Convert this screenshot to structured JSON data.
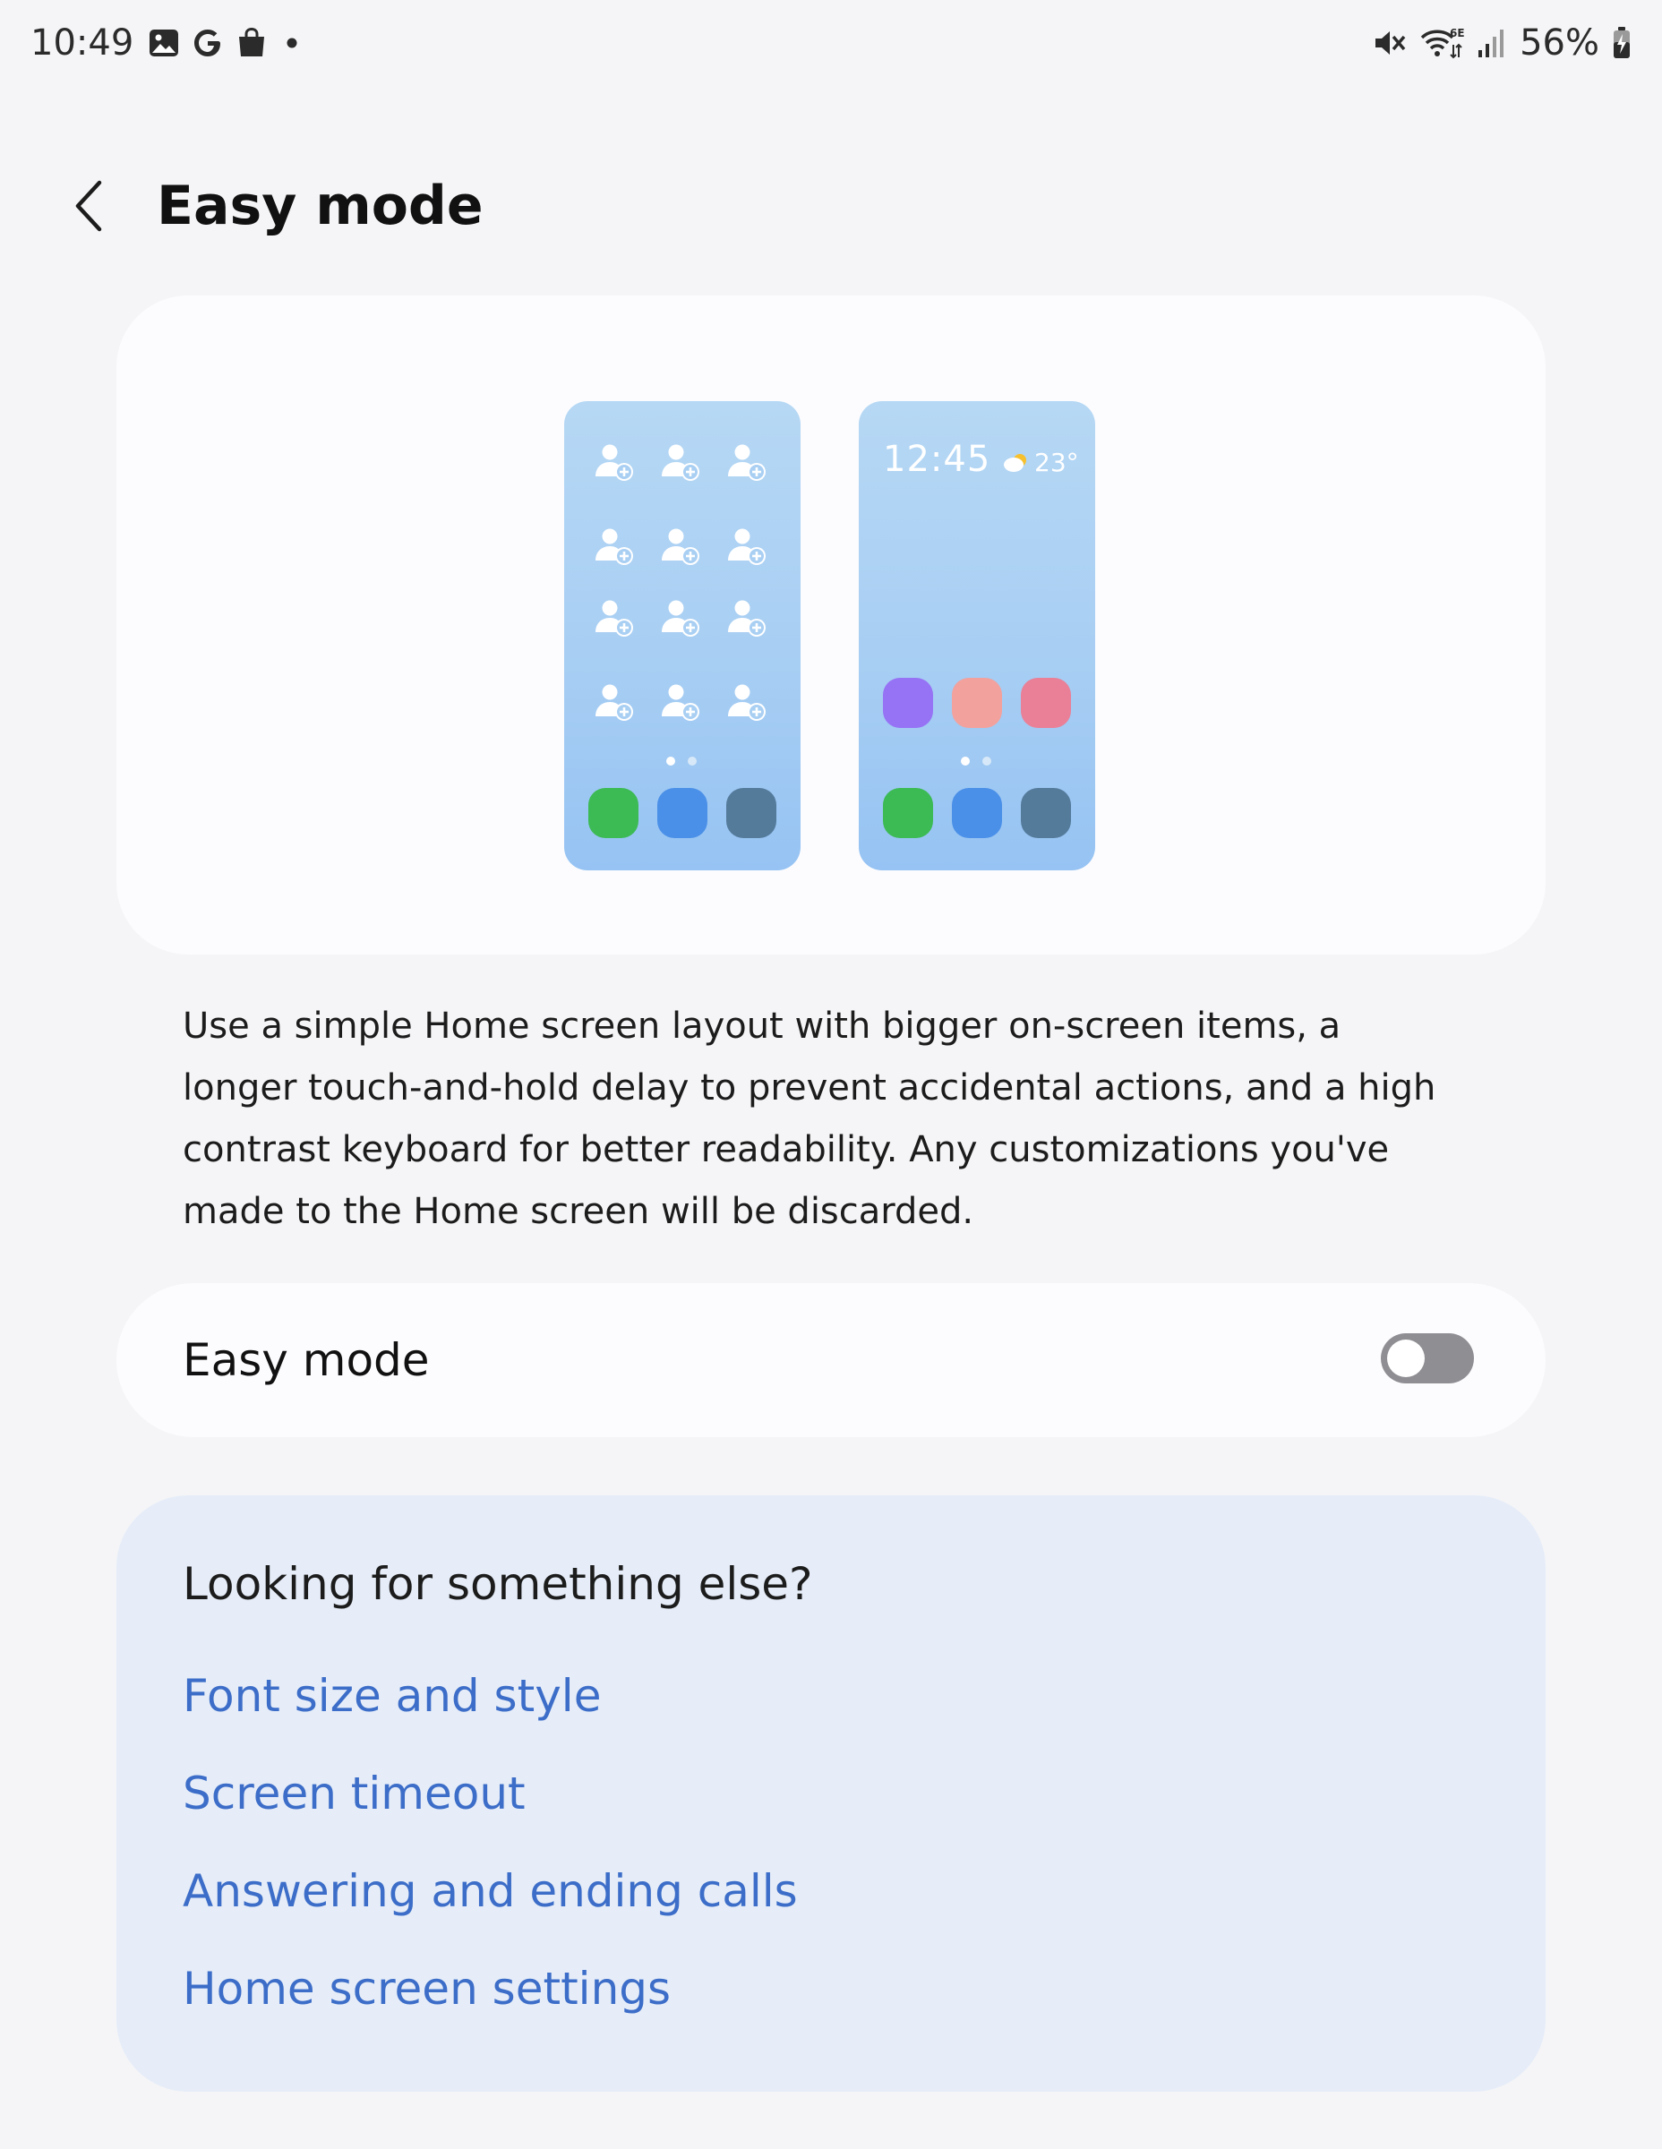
{
  "status_bar": {
    "time": "10:49",
    "left_icons": [
      "gallery-icon",
      "google-icon",
      "shopping-bag-icon",
      "notification-dot-icon"
    ],
    "right_icons": [
      "mute-icon",
      "wifi-6e-icon",
      "cellular-signal-icon",
      "battery-charging-icon"
    ],
    "battery_percent": "56%"
  },
  "header": {
    "title": "Easy mode",
    "back_icon": "chevron-left-icon"
  },
  "illustration": {
    "standard_phone": {
      "contact_icon": "add-contact-icon",
      "dock_colors": [
        "#3cba54",
        "#4a90e8",
        "#557b9b"
      ]
    },
    "easy_phone": {
      "clock": "12:45",
      "weather_icon": "partly-sunny-icon",
      "temperature": "23°",
      "app_colors": [
        "#9672f5",
        "#f2a19d",
        "#e98098"
      ],
      "dock_colors": [
        "#3cba54",
        "#4a90e8",
        "#557b9b"
      ]
    }
  },
  "description": "Use a simple Home screen layout with bigger on-screen items, a longer touch-and-hold delay to prevent accidental actions, and a high contrast keyboard for better readability. Any customizations you've made to the Home screen will be discarded.",
  "toggle": {
    "label": "Easy mode",
    "enabled": false
  },
  "suggestions": {
    "heading": "Looking for something else?",
    "links": [
      "Font size and style",
      "Screen timeout",
      "Answering and ending calls",
      "Home screen settings"
    ]
  },
  "colors": {
    "background": "#f5f5f7",
    "card": "#fcfcfe",
    "suggestions_card": "#e6edf8",
    "link": "#3c6dc8",
    "switch_off": "#8e8e93"
  }
}
